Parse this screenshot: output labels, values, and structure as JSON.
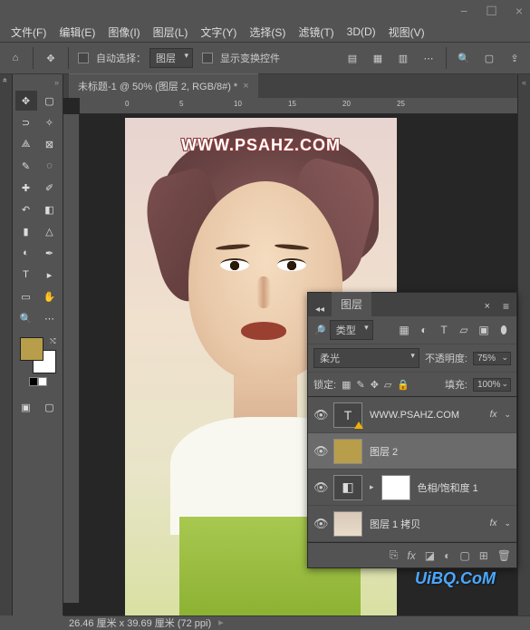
{
  "window": {
    "minimize": "−",
    "maximize": "☐",
    "close": "×"
  },
  "menu": [
    "文件(F)",
    "编辑(E)",
    "图像(I)",
    "图层(L)",
    "文字(Y)",
    "选择(S)",
    "滤镜(T)",
    "3D(D)",
    "视图(V)"
  ],
  "options": {
    "auto_select_label": "自动选择：",
    "auto_select_value": "图层",
    "transform_label": "显示变换控件"
  },
  "doc_tab": "未标题-1 @ 50% (图层 2, RGB/8#) *",
  "ruler_marks": [
    "0",
    "5",
    "10",
    "15",
    "20",
    "25"
  ],
  "watermark_top": "WWW.PSAHZ.COM",
  "watermark_bottom": "UiBQ.CoM",
  "status": {
    "left": "26.46 厘米 x 39.69 厘米 (72 ppi)",
    "chev": "▸"
  },
  "swatches": {
    "fg": "#b89e4a",
    "bg": "#ffffff"
  },
  "layers_panel": {
    "title": "图层",
    "filter_label": "类型",
    "blend_mode": "柔光",
    "opacity_label": "不透明度:",
    "opacity_value": "75%",
    "lock_label": "锁定:",
    "fill_label": "填充:",
    "fill_value": "100%",
    "layers": [
      {
        "name": "WWW.PSAHZ.COM",
        "type": "text",
        "fx": true,
        "visible": true
      },
      {
        "name": "图层 2",
        "type": "gold",
        "fx": false,
        "visible": true,
        "selected": true
      },
      {
        "name": "色相/饱和度 1",
        "type": "adj",
        "fx": false,
        "visible": true,
        "mask": true
      },
      {
        "name": "图层 1 拷贝",
        "type": "img",
        "fx": true,
        "visible": true
      }
    ]
  }
}
